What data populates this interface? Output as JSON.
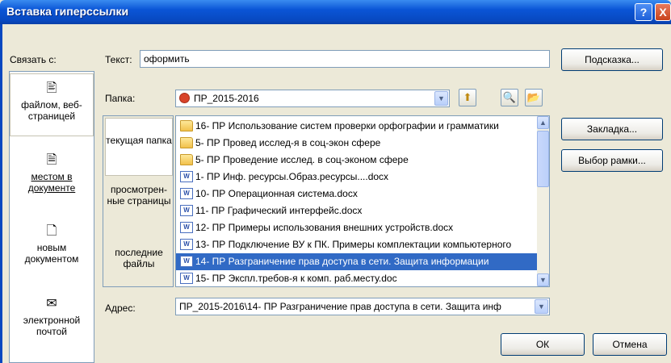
{
  "window": {
    "title": "Вставка гиперссылки",
    "help": "?",
    "close": "X"
  },
  "link_to": {
    "label": "Связать с:",
    "items": [
      {
        "label": "файлом, веб-страницей",
        "icon": "web-page-icon"
      },
      {
        "label": "местом в документе",
        "icon": "place-in-document-icon"
      },
      {
        "label": "новым документом",
        "icon": "new-document-icon"
      },
      {
        "label": "электронной почтой",
        "icon": "email-icon"
      }
    ]
  },
  "text_field": {
    "label": "Текст:",
    "value": "оформить"
  },
  "buttons": {
    "hint": "Подсказка...",
    "bookmark": "Закладка...",
    "frame": "Выбор рамки...",
    "ok": "ОК",
    "cancel": "Отмена"
  },
  "folder": {
    "label": "Папка:",
    "value": "ПР_2015-2016"
  },
  "look_in": {
    "items": [
      {
        "label": "текущая папка"
      },
      {
        "label": "просмотрен-ные страницы"
      },
      {
        "label": "последние файлы"
      }
    ]
  },
  "files": [
    {
      "type": "folder",
      "name": "16- ПР Использование систем проверки орфографии и грамматики"
    },
    {
      "type": "folder",
      "name": "5- ПР Провед исслед-я в соц-экон сфере"
    },
    {
      "type": "folder",
      "name": "5- ПР Проведение исслед. в соц-эконом сфере"
    },
    {
      "type": "doc",
      "name": "1- ПР Инф. ресурсы.Образ.ресурсы....docx"
    },
    {
      "type": "doc",
      "name": "10- ПР Операционная система.docx"
    },
    {
      "type": "doc",
      "name": "11- ПР Графический интерфейс.docx"
    },
    {
      "type": "doc",
      "name": "12- ПР Примеры использования внешних устройств.docx"
    },
    {
      "type": "doc",
      "name": "13- ПР Подключение ВУ к ПК. Примеры комплектации компьютерного"
    },
    {
      "type": "doc",
      "name": "14- ПР Разграничение прав доступа в сети. Защита информации"
    },
    {
      "type": "doc",
      "name": "15- ПР Экспл.требов-я к комп. раб.месту.doc"
    }
  ],
  "selected_index": 8,
  "address": {
    "label": "Адрес:",
    "value": "ПР_2015-2016\\14- ПР Разграничение прав доступа в сети. Защита инф"
  }
}
